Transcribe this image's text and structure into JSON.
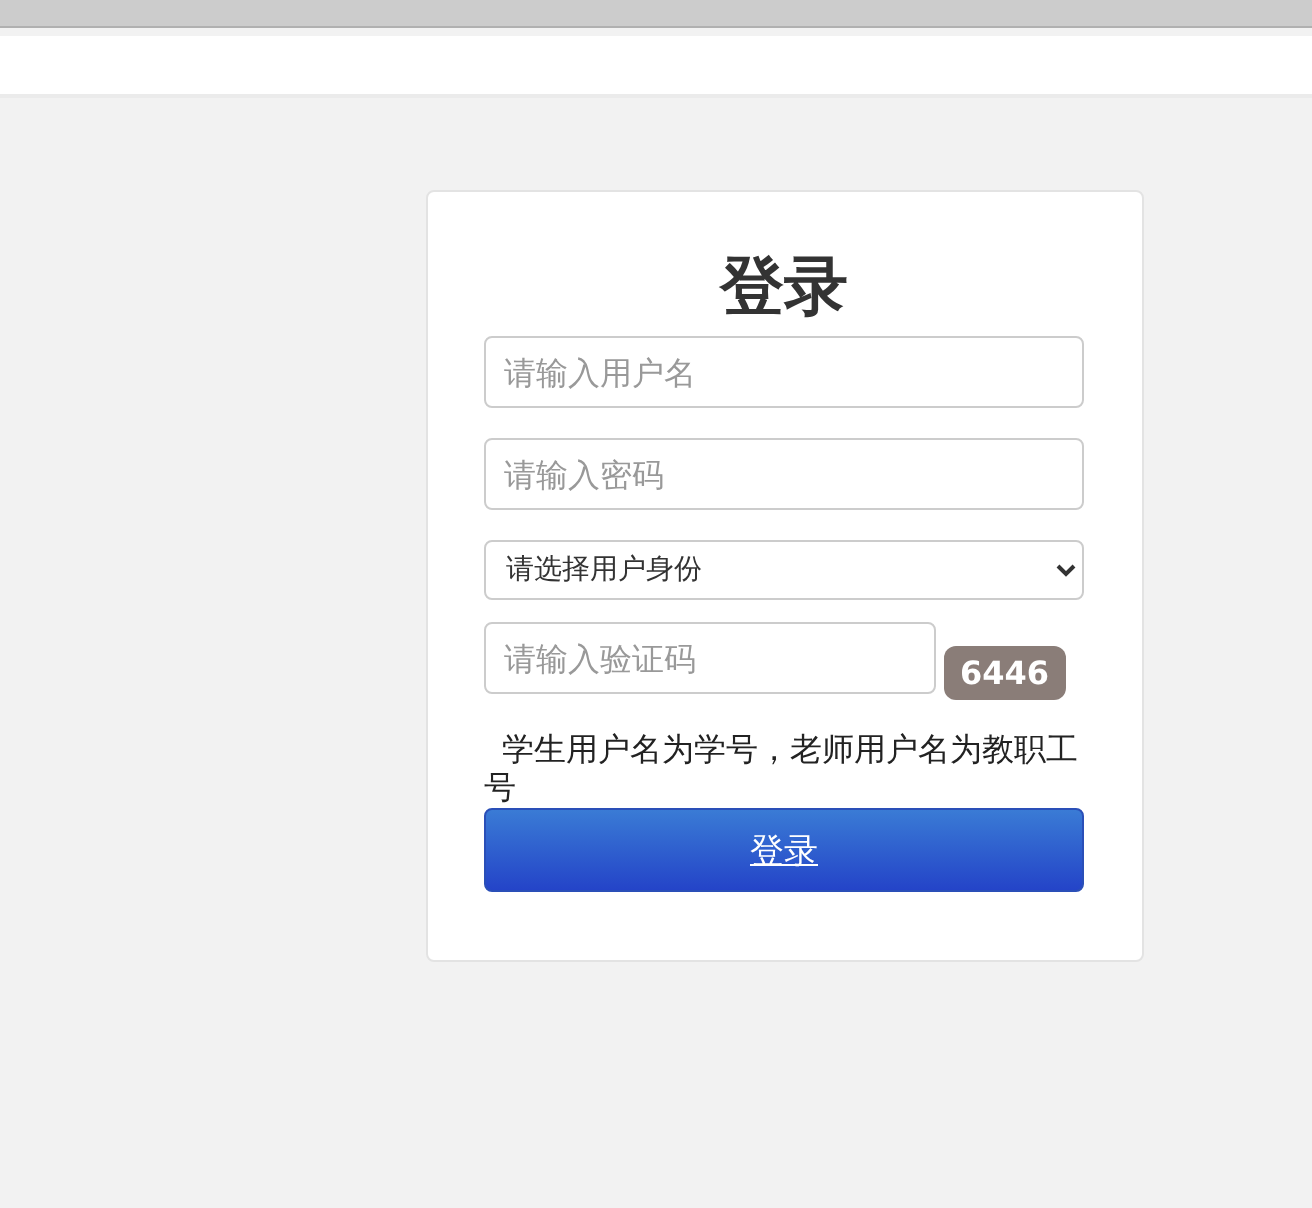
{
  "login_form": {
    "title": "登录",
    "username": {
      "placeholder": "请输入用户名"
    },
    "password": {
      "placeholder": "请输入密码"
    },
    "role": {
      "value": "请选择用户身份"
    },
    "captcha": {
      "placeholder": "请输入验证码",
      "code": "6446"
    },
    "hint": "学生用户名为学号，老师用户名为教职工号",
    "submit": "登录"
  }
}
